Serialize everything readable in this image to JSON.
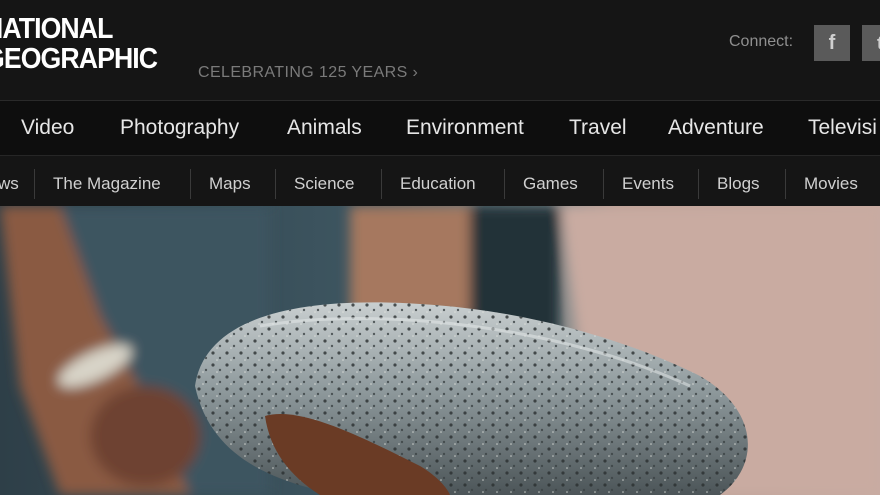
{
  "header": {
    "logo_line1": "NATIONAL",
    "logo_line2": "GEOGRAPHIC",
    "tagline": "CELEBRATING 125 YEARS ›",
    "connect_label": "Connect:",
    "social": [
      {
        "label": "f",
        "icon": "facebook-icon"
      },
      {
        "label": "t",
        "icon": "twitter-icon"
      }
    ]
  },
  "primary_nav": [
    "Video",
    "Photography",
    "Animals",
    "Environment",
    "Travel",
    "Adventure",
    "Televisi"
  ],
  "secondary_nav": [
    "ws",
    "The Magazine",
    "Maps",
    "Science",
    "Education",
    "Games",
    "Events",
    "Blogs",
    "Movies"
  ],
  "colors": {
    "background": "#151515",
    "nav_text": "#e6e6e6",
    "tagline": "#7a7a7a",
    "social_bg": "#5a5a5a"
  }
}
